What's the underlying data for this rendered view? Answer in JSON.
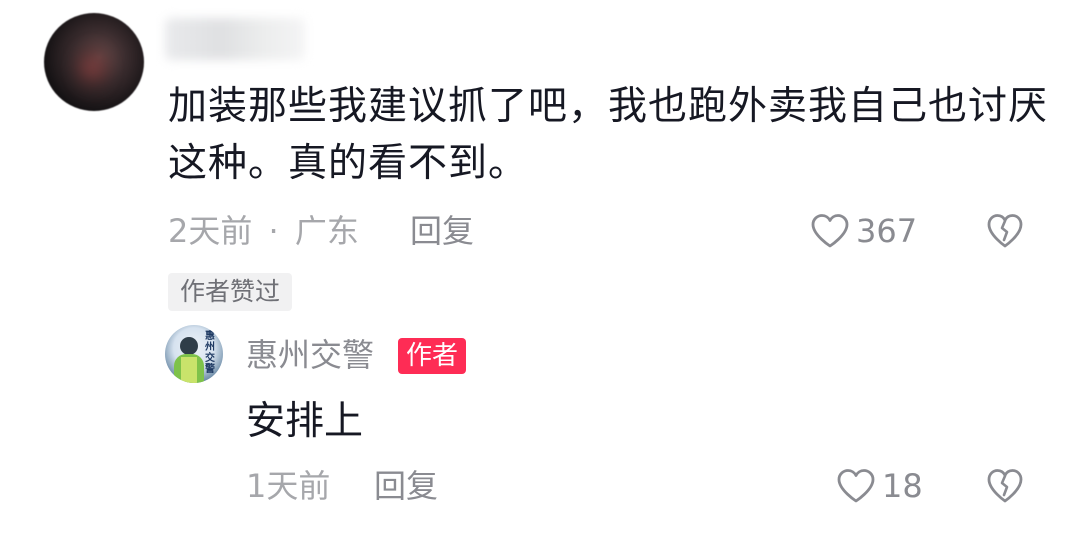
{
  "comment": {
    "text": "加装那些我建议抓了吧，我也跑外卖我自己也讨厌这种。真的看不到。",
    "time": "2天前",
    "location": "广东",
    "separator": "·",
    "reply_label": "回复",
    "like_count": "367",
    "author_liked_tag": "作者赞过",
    "icons": {
      "like": "heart-outline-icon",
      "dislike": "broken-heart-icon"
    }
  },
  "reply": {
    "username": "惠州交警",
    "avatar_text": "惠州交警",
    "author_badge": "作者",
    "text": "安排上",
    "time": "1天前",
    "reply_label": "回复",
    "like_count": "18"
  },
  "colors": {
    "text_primary": "#161823",
    "text_secondary": "#8a8b91",
    "badge_red": "#fe2c55"
  }
}
